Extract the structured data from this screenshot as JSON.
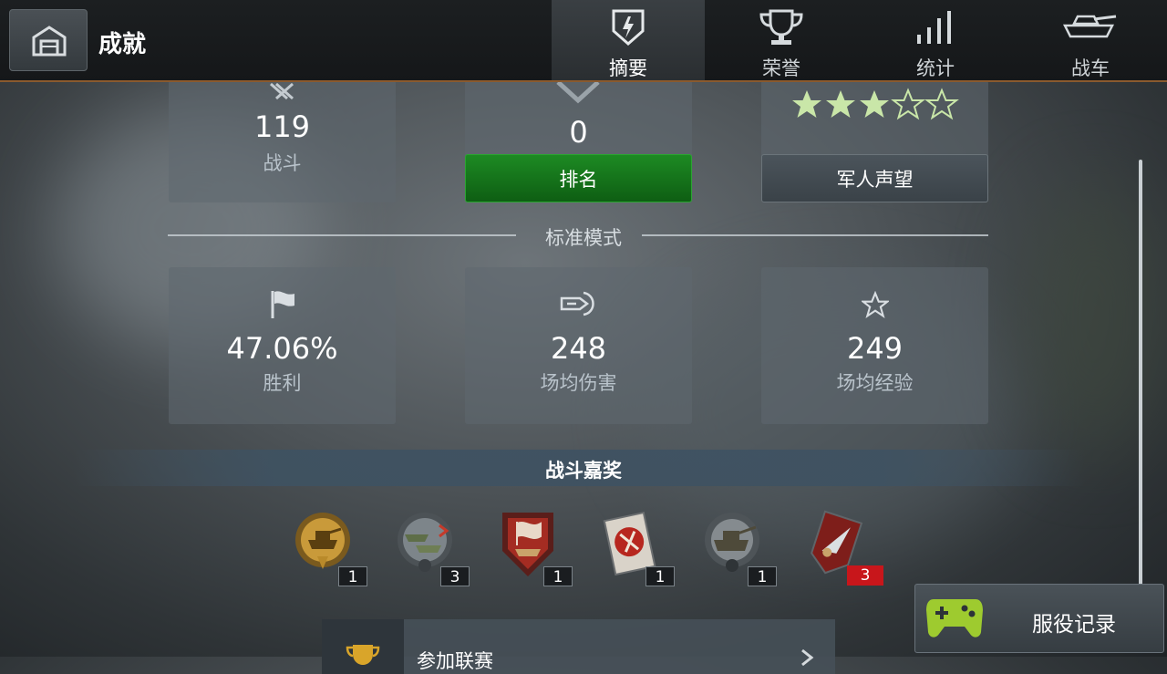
{
  "header": {
    "title": "成就",
    "tabs": [
      {
        "label": "摘要",
        "icon": "summary-shield-icon",
        "active": true
      },
      {
        "label": "荣誉",
        "icon": "trophy-icon",
        "active": false
      },
      {
        "label": "统计",
        "icon": "stats-bars-icon",
        "active": false
      },
      {
        "label": "战车",
        "icon": "tank-icon",
        "active": false
      }
    ]
  },
  "top_cards": {
    "battles": {
      "value": "119",
      "label": "战斗"
    },
    "rank": {
      "value": "0",
      "button": "排名"
    },
    "reputation": {
      "stars_filled": 3,
      "stars_total": 5,
      "button": "军人声望"
    }
  },
  "mode": {
    "title": "标准模式"
  },
  "stats": [
    {
      "value": "47.06%",
      "label": "胜利",
      "icon": "flag-icon"
    },
    {
      "value": "248",
      "label": "场均伤害",
      "icon": "shell-damage-icon"
    },
    {
      "value": "249",
      "label": "场均经验",
      "icon": "star-outline-icon"
    }
  ],
  "awards": {
    "title": "战斗嘉奖",
    "medals": [
      {
        "name": "gold-tank-wreath-medal",
        "count": "1"
      },
      {
        "name": "twin-tanks-medal",
        "count": "3"
      },
      {
        "name": "red-shield-medal",
        "count": "1"
      },
      {
        "name": "kamikaze-card-medal",
        "count": "1"
      },
      {
        "name": "heavy-tank-wreath-medal",
        "count": "1"
      },
      {
        "name": "red-dagger-medal",
        "count": "3"
      }
    ]
  },
  "service_record": {
    "label": "服役记录",
    "icon": "gamepad-icon",
    "accent": "#9ecb2f"
  },
  "bottom_item": {
    "label": "参加联赛",
    "icon": "gold-cup-icon"
  },
  "colors": {
    "accent_orange": "#8a5a2e",
    "green_button": "#1d8a23",
    "star_fill": "#c9e6a8"
  }
}
